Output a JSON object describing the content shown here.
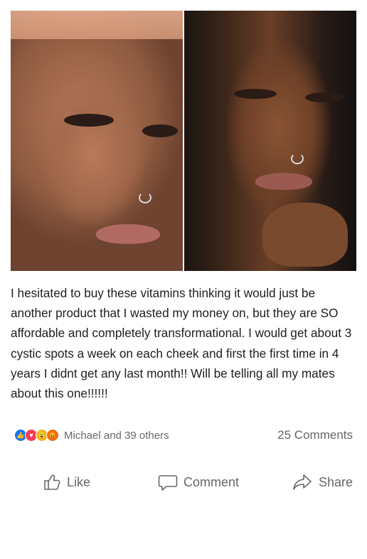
{
  "post": {
    "text": "I hesitated to buy these vitamins thinking it would just be another product that I wasted my money on, but they are SO affordable and completely transformational. I would get about 3 cystic spots a week on each cheek and first the first time in 4 years I didnt get any last month!! Will be telling all my mates about this one!!!!!!"
  },
  "reactions": {
    "icons": [
      "like-reaction",
      "love-reaction",
      "wow-reaction",
      "angry-reaction"
    ],
    "summary": "Michael and 39 others"
  },
  "comments": {
    "count_label": "25 Comments"
  },
  "actions": {
    "like_label": "Like",
    "comment_label": "Comment",
    "share_label": "Share"
  }
}
